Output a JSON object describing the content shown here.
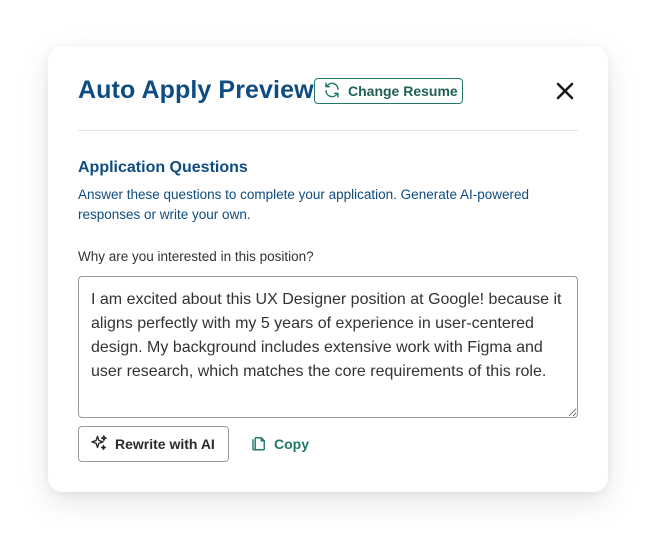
{
  "modal": {
    "title": "Auto Apply Preview",
    "change_resume_label": "Change Resume"
  },
  "questions": {
    "section_title": "Application Questions",
    "section_description": "Answer these questions to complete your application. Generate AI-powered responses or write your own.",
    "items": [
      {
        "label": "Why are you interested in this position?",
        "answer": "I am excited about this UX Designer position at Google! because it aligns perfectly with my 5 years of experience in user-centered design. My background includes extensive work with Figma and user research, which matches the core requirements of this role."
      }
    ]
  },
  "actions": {
    "rewrite_label": "Rewrite with AI",
    "copy_label": "Copy"
  },
  "icons": {
    "change_resume": "refresh-icon",
    "close": "close-icon",
    "rewrite": "sparkle-icon",
    "copy": "copy-icon"
  },
  "colors": {
    "title": "#0f4c81",
    "accent": "#1f7a6a",
    "border": "#9a9a9a"
  }
}
